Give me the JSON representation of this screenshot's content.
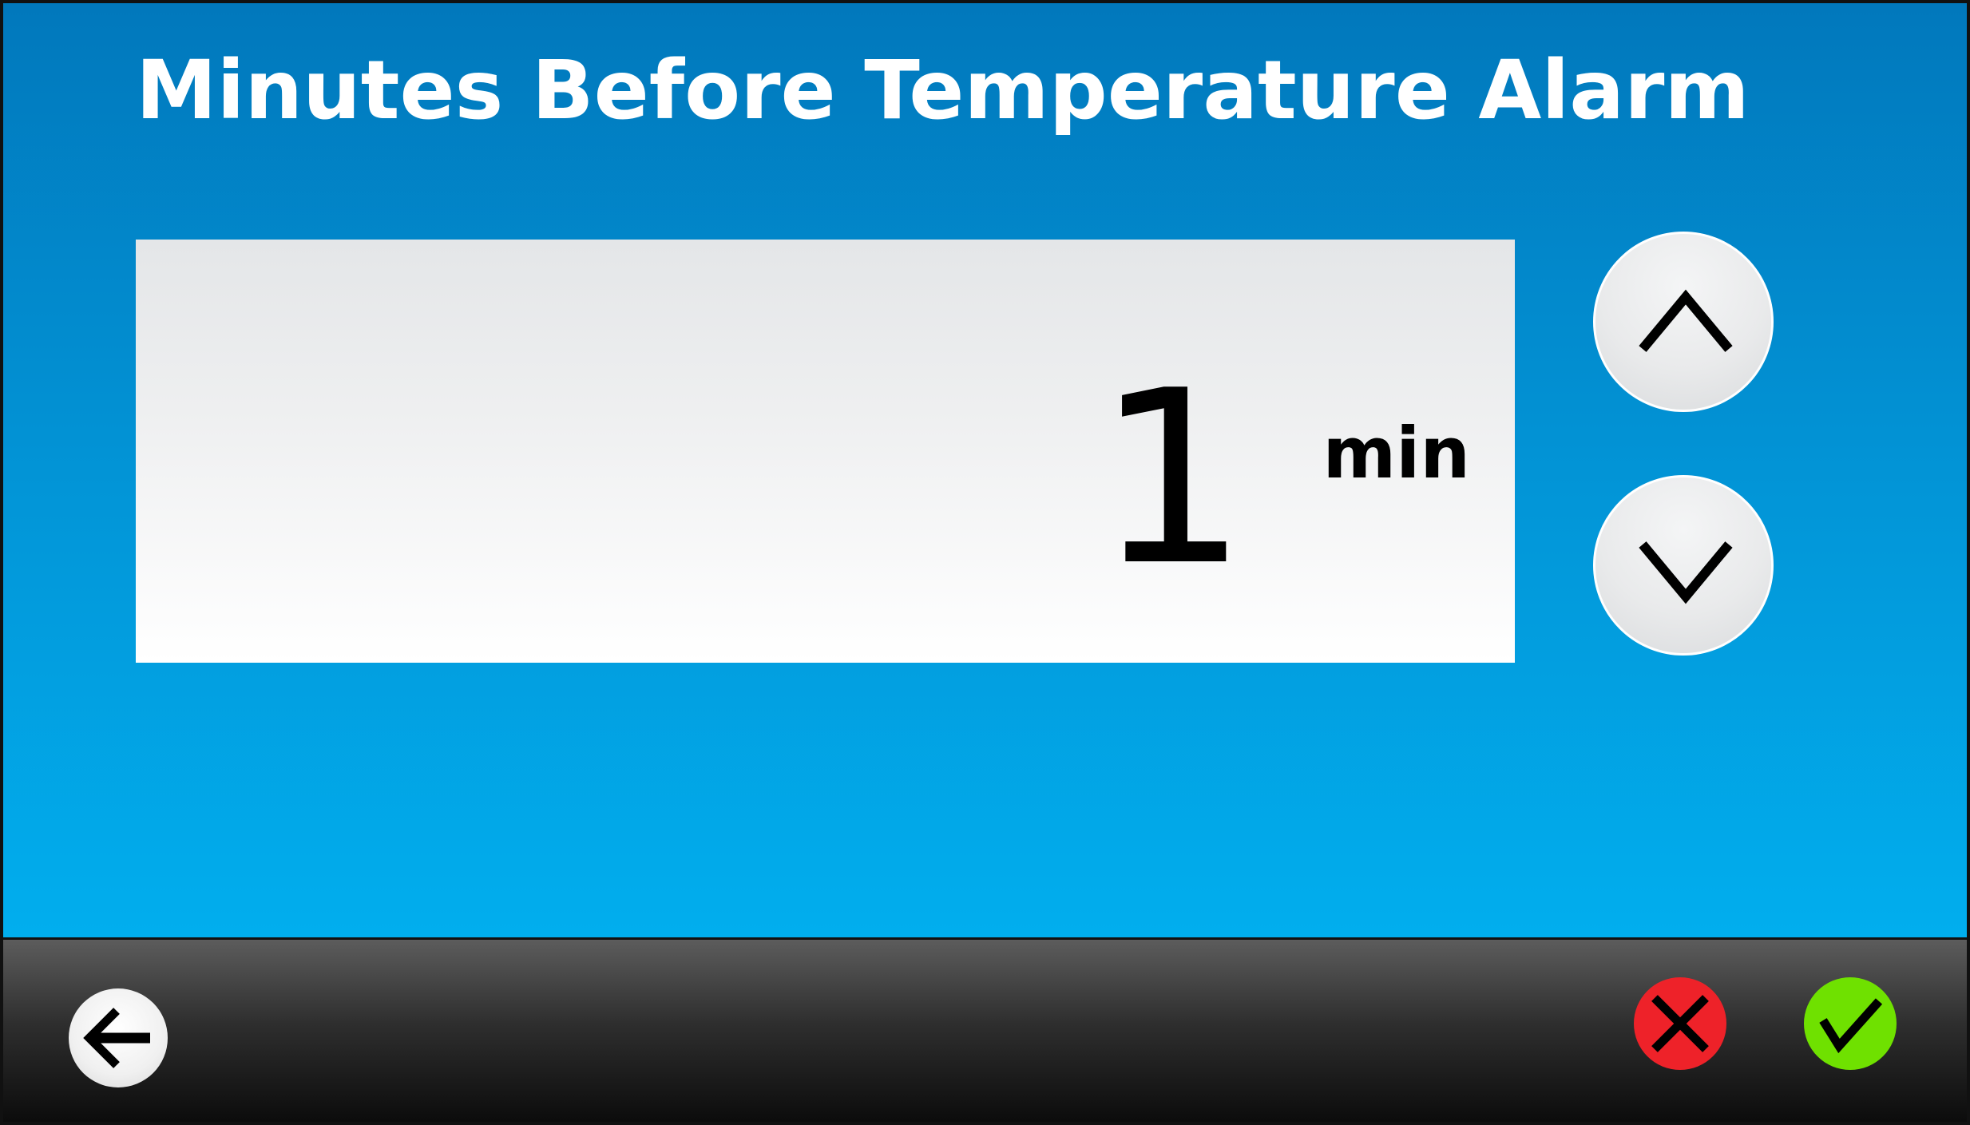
{
  "screen": {
    "title": "Minutes Before Temperature Alarm"
  },
  "value": {
    "number": "1",
    "unit": "min"
  },
  "icons": {
    "increment": "chevron-up-icon",
    "decrement": "chevron-down-icon",
    "back": "arrow-left-icon",
    "cancel": "close-icon",
    "confirm": "checkmark-icon"
  },
  "colors": {
    "panel_top": "#0178bc",
    "panel_bottom": "#01aeee",
    "cancel": "#ee2229",
    "confirm": "#6fe100"
  }
}
